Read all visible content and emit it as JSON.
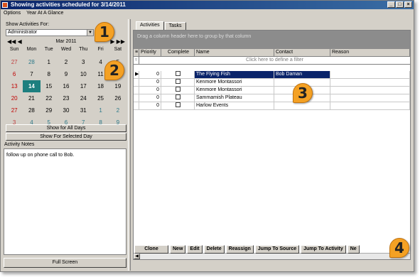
{
  "window": {
    "title": "Showing activities scheduled for 3/14/2011",
    "controls": [
      "_",
      "□",
      "×"
    ]
  },
  "menu": {
    "items": [
      "Options",
      "Year At A Glance"
    ]
  },
  "left": {
    "show_for_label": "Show Activities For:",
    "selected_user": "Administrator",
    "calendar": {
      "month": "Mar 2011",
      "nav_prev": "◀◀ ◀",
      "nav_next": "▶ ▶▶",
      "dow": [
        "Sun",
        "Mon",
        "Tue",
        "Wed",
        "Thu",
        "Fri",
        "Sat"
      ],
      "weeks": [
        [
          "27",
          "28",
          "1",
          "2",
          "3",
          "4",
          "5"
        ],
        [
          "6",
          "7",
          "8",
          "9",
          "10",
          "11",
          "12"
        ],
        [
          "13",
          "14",
          "15",
          "16",
          "17",
          "18",
          "19"
        ],
        [
          "20",
          "21",
          "22",
          "23",
          "24",
          "25",
          "26"
        ],
        [
          "27",
          "28",
          "29",
          "30",
          "31",
          "1",
          "2"
        ],
        [
          "3",
          "4",
          "5",
          "6",
          "7",
          "8",
          "9"
        ]
      ],
      "today": "14"
    },
    "show_all_days": "Show for All Days",
    "show_selected_day": "Show For Selected Day",
    "notes_label": "Activity Notes",
    "notes_text": "follow up on phone call to Bob.",
    "full_screen": "Full Screen"
  },
  "right": {
    "tabs": [
      "Activities",
      "Tasks"
    ],
    "group_hint": "Drag a column header here to group by that column",
    "columns": [
      "Priority",
      "Complete",
      "Name",
      "Contact",
      "Reason"
    ],
    "filter_hint": "Click here to define a filter",
    "rows": [
      {
        "priority": "0",
        "name": "The Flying Fish",
        "contact": "Bob Daman",
        "reason": ""
      },
      {
        "priority": "0",
        "name": "Kenmore Montassori",
        "contact": "",
        "reason": ""
      },
      {
        "priority": "0",
        "name": "Kenmore Montassori",
        "contact": "",
        "reason": ""
      },
      {
        "priority": "0",
        "name": "Sammamish Plateau",
        "contact": "",
        "reason": ""
      },
      {
        "priority": "0",
        "name": "Harlow Events",
        "contact": "",
        "reason": ""
      }
    ],
    "toolbar": [
      "Clone",
      "New",
      "Edit",
      "Delete",
      "Reassign",
      "Jump To Source",
      "Jump To Activity",
      "Ne"
    ]
  },
  "callouts": [
    "1",
    "2",
    "3",
    "4"
  ]
}
